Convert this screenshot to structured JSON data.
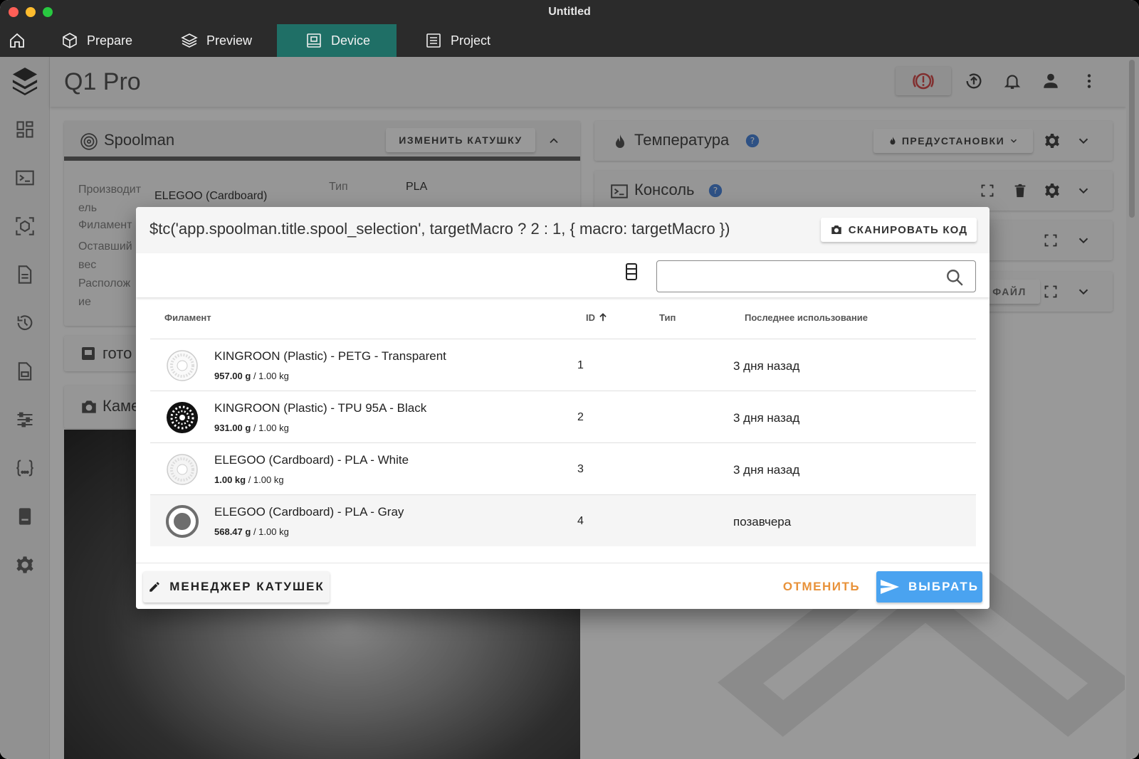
{
  "window": {
    "title": "Untitled"
  },
  "app_tabs": [
    {
      "label": "Prepare",
      "icon": "cube-icon"
    },
    {
      "label": "Preview",
      "icon": "layers-icon"
    },
    {
      "label": "Device",
      "icon": "device-icon",
      "active": true
    },
    {
      "label": "Project",
      "icon": "list-icon"
    }
  ],
  "header": {
    "printer_name": "Q1 Pro"
  },
  "spoolman_card": {
    "title": "Spoolman",
    "change_button": "ИЗМЕНИТЬ КАТУШКУ",
    "labels": {
      "manufacturer": "Производит\nель",
      "type": "Тип",
      "filament": "Филамент",
      "remaining": "Оставший\nвес",
      "location": "Располож\nие"
    },
    "manufacturer_value": "ELEGOO (Cardboard)",
    "type_value": "PLA"
  },
  "ready_card": {
    "title": "гото"
  },
  "camera_card": {
    "title": "Каме"
  },
  "temperature_card": {
    "title": "Температура",
    "presets_button": "ПРЕДУСТАНОВКИ"
  },
  "console_card": {
    "title": "Консоль"
  },
  "file_button_fragment": "ФАЙЛ",
  "dialog": {
    "title": "$tc('app.spoolman.title.spool_selection', targetMacro ? 2 : 1, { macro: targetMacro })",
    "scan_button": "СКАНИРОВАТЬ КОД",
    "search": {
      "value": "",
      "placeholder": ""
    },
    "columns": {
      "filament": "Филамент",
      "id": "ID",
      "type": "Тип",
      "last_used": "Последнее использование"
    },
    "rows": [
      {
        "name": "KINGROON (Plastic) - PETG - Transparent",
        "remaining": "957.00 g",
        "total": " / 1.00 kg",
        "id": "1",
        "type": "",
        "last_used": "3 дня назад",
        "spool_color": "#e8e8e8"
      },
      {
        "name": "KINGROON (Plastic) - TPU 95A - Black",
        "remaining": "931.00 g",
        "total": " / 1.00 kg",
        "id": "2",
        "type": "",
        "last_used": "3 дня назад",
        "spool_color": "#111111"
      },
      {
        "name": "ELEGOO (Cardboard) - PLA - White",
        "remaining": "1.00 kg",
        "total": " / 1.00 kg",
        "id": "3",
        "type": "",
        "last_used": "3 дня назад",
        "spool_color": "#f2f2f2"
      },
      {
        "name": "ELEGOO (Cardboard) - PLA - Gray",
        "remaining": "568.47 g",
        "total": " / 1.00 kg",
        "id": "4",
        "type": "",
        "last_used": "позавчера",
        "spool_color": "#6e6e6e"
      }
    ],
    "manager_button": "МЕНЕДЖЕР КАТУШЕК",
    "cancel_button": "ОТМЕНИТЬ",
    "select_button": "ВЫБРАТЬ"
  },
  "colors": {
    "accent": "#1f6f66",
    "primary": "#4aa3f0",
    "warning": "#e8923a",
    "danger": "#d33a3a"
  }
}
